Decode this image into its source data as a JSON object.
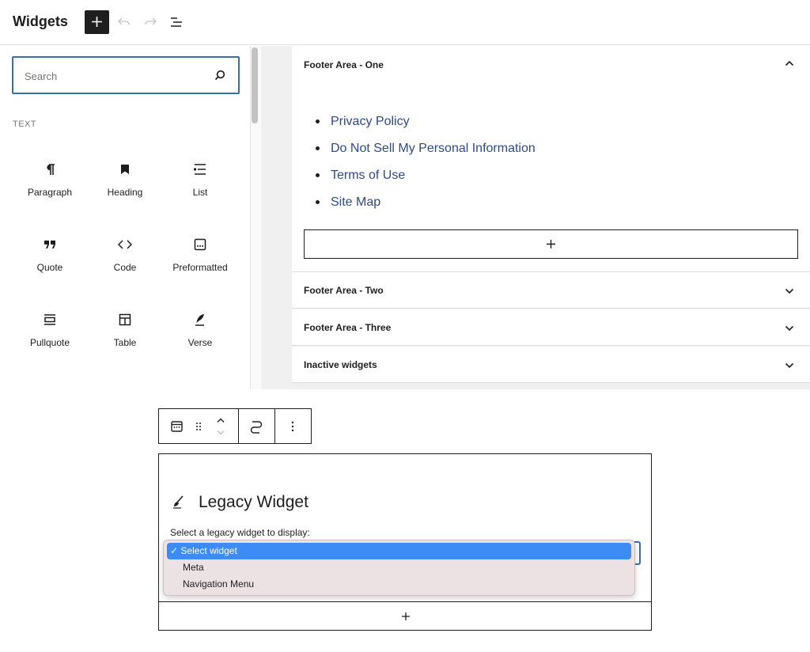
{
  "header": {
    "title": "Widgets",
    "add_icon": "plus-icon",
    "undo_icon": "undo-icon",
    "redo_icon": "redo-icon",
    "list_view_icon": "list-view-icon"
  },
  "inserter": {
    "search_placeholder": "Search",
    "category": "TEXT",
    "blocks": [
      {
        "label": "Paragraph",
        "icon": "paragraph-icon"
      },
      {
        "label": "Heading",
        "icon": "heading-icon"
      },
      {
        "label": "List",
        "icon": "list-icon"
      },
      {
        "label": "Quote",
        "icon": "quote-icon"
      },
      {
        "label": "Code",
        "icon": "code-icon"
      },
      {
        "label": "Preformatted",
        "icon": "preformatted-icon"
      },
      {
        "label": "Pullquote",
        "icon": "pullquote-icon"
      },
      {
        "label": "Table",
        "icon": "table-icon"
      },
      {
        "label": "Verse",
        "icon": "verse-icon"
      }
    ]
  },
  "areas": [
    {
      "name": "Footer Area - One",
      "expanded": true
    },
    {
      "name": "Footer Area - Two",
      "expanded": false
    },
    {
      "name": "Footer Area - Three",
      "expanded": false
    },
    {
      "name": "Inactive widgets",
      "expanded": false
    }
  ],
  "footer_links": [
    "Privacy Policy",
    "Do Not Sell My Personal Information",
    "Terms of Use",
    "Site Map"
  ],
  "block_toolbar": {
    "icons": [
      "calendar-icon",
      "drag-handle-icon",
      "move-up-icon",
      "move-down-icon",
      "transform-icon",
      "more-options-icon"
    ]
  },
  "legacy_widget": {
    "title": "Legacy Widget",
    "prompt": "Select a legacy widget to display:",
    "options": [
      "Select widget",
      "Meta",
      "Navigation Menu"
    ],
    "selected_index": 0,
    "selected_mark": "✓"
  },
  "colors": {
    "accent": "#3870aa",
    "link": "#2d4a8a",
    "highlight": "#3d8bf5"
  }
}
